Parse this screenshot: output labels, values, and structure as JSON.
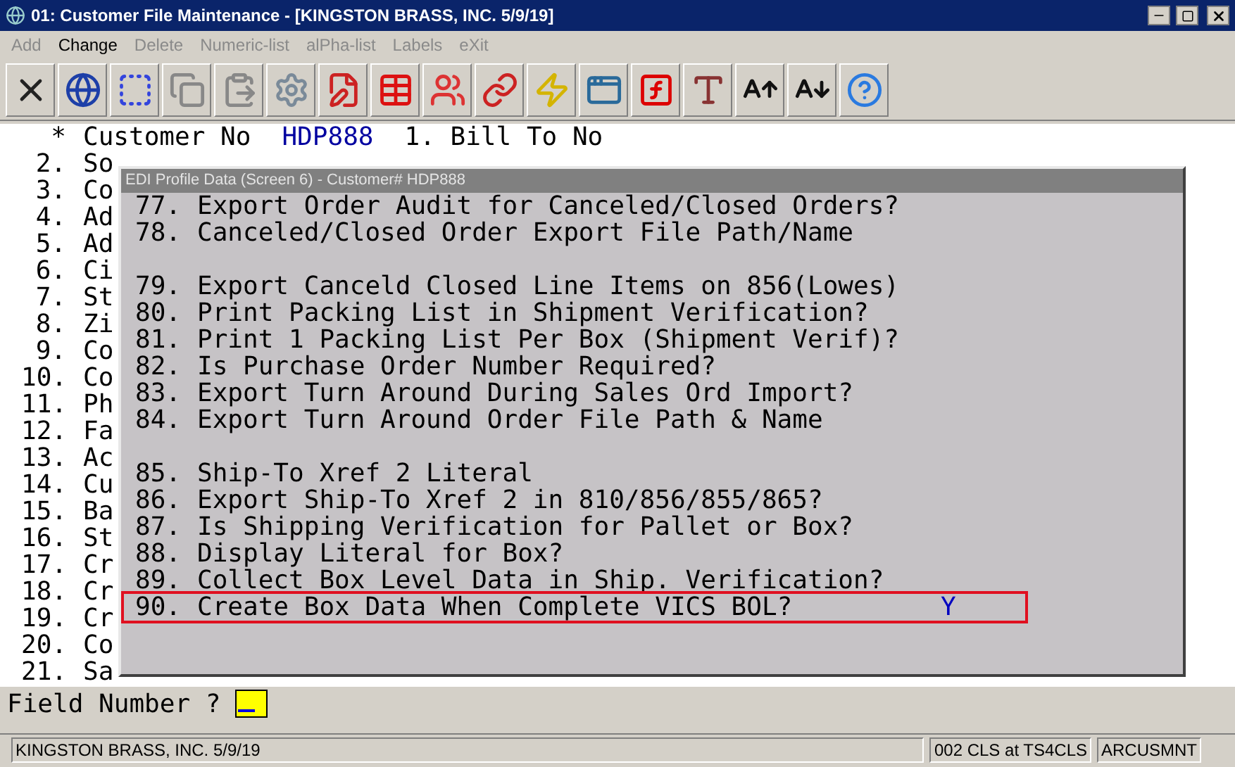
{
  "window": {
    "title": "01: Customer File Maintenance - [KINGSTON BRASS, INC. 5/9/19]"
  },
  "menu": [
    {
      "label": "Add",
      "disabled": true
    },
    {
      "label": "Change",
      "disabled": false
    },
    {
      "label": "Delete",
      "disabled": true
    },
    {
      "label": "Numeric-list",
      "disabled": true
    },
    {
      "label": "alPha-list",
      "disabled": true
    },
    {
      "label": "Labels",
      "disabled": true
    },
    {
      "label": "eXit",
      "disabled": true
    }
  ],
  "terminal": {
    "rows": [
      {
        "number": "*",
        "label": "Customer No",
        "value": "HDP888",
        "extra": "1. Bill To No"
      },
      {
        "number": "2.",
        "label": "So"
      },
      {
        "number": "3.",
        "label": "Co"
      },
      {
        "number": "4.",
        "label": "Ad"
      },
      {
        "number": "5.",
        "label": "Ad"
      },
      {
        "number": "6.",
        "label": "Ci"
      },
      {
        "number": "7.",
        "label": "St"
      },
      {
        "number": "8.",
        "label": "Zi"
      },
      {
        "number": "9.",
        "label": "Co"
      },
      {
        "number": "10.",
        "label": "Co"
      },
      {
        "number": "11.",
        "label": "Ph"
      },
      {
        "number": "12.",
        "label": "Fa"
      },
      {
        "number": "13.",
        "label": "Ac"
      },
      {
        "number": "14.",
        "label": "Cu"
      },
      {
        "number": "15.",
        "label": "Ba"
      },
      {
        "number": "16.",
        "label": "St"
      },
      {
        "number": "17.",
        "label": "Cr"
      },
      {
        "number": "18.",
        "label": "Cr"
      },
      {
        "number": "19.",
        "label": "Cr"
      },
      {
        "number": "20.",
        "label": "Co"
      },
      {
        "number": "21.",
        "label": "Sa"
      }
    ]
  },
  "dialog": {
    "title": "EDI Profile Data (Screen 6) - Customer# HDP888",
    "items": [
      {
        "kind": "item",
        "number": "77.",
        "label": "Export Order Audit for Canceled/Closed Orders?",
        "highlighted": false
      },
      {
        "kind": "item",
        "number": "78.",
        "label": "Canceled/Closed Order Export File Path/Name",
        "highlighted": false
      },
      {
        "kind": "blank"
      },
      {
        "kind": "item",
        "number": "79.",
        "label": "Export Canceld Closed Line Items on 856(Lowes)",
        "highlighted": false
      },
      {
        "kind": "item",
        "number": "80.",
        "label": "Print Packing List in Shipment Verification?",
        "highlighted": false
      },
      {
        "kind": "item",
        "number": "81.",
        "label": "Print 1 Packing List Per Box (Shipment Verif)?",
        "highlighted": false
      },
      {
        "kind": "item",
        "number": "82.",
        "label": "Is Purchase Order Number Required?",
        "highlighted": false
      },
      {
        "kind": "item",
        "number": "83.",
        "label": "Export Turn Around During Sales Ord Import?",
        "highlighted": false
      },
      {
        "kind": "item",
        "number": "84.",
        "label": "Export Turn Around Order File Path & Name",
        "highlighted": false
      },
      {
        "kind": "blank"
      },
      {
        "kind": "item",
        "number": "85.",
        "label": "Ship-To Xref 2 Literal",
        "highlighted": false
      },
      {
        "kind": "item",
        "number": "86.",
        "label": "Export Ship-To Xref 2 in 810/856/855/865?",
        "highlighted": false
      },
      {
        "kind": "item",
        "number": "87.",
        "label": "Is Shipping Verification for Pallet or Box?",
        "highlighted": false
      },
      {
        "kind": "item",
        "number": "88.",
        "label": "Display Literal for Box?",
        "highlighted": false
      },
      {
        "kind": "item",
        "number": "89.",
        "label": "Collect Box Level Data in Ship. Verification?",
        "highlighted": false
      },
      {
        "kind": "item",
        "number": "90.",
        "label": "Create Box Data When Complete VICS BOL?",
        "value": "Y",
        "highlighted": true
      }
    ]
  },
  "prompt": {
    "label": "Field Number ?"
  },
  "status_bar": [
    "KINGSTON BRASS, INC. 5/9/19",
    "002 CLS at TS4CLS",
    "ARCUSMNT"
  ]
}
